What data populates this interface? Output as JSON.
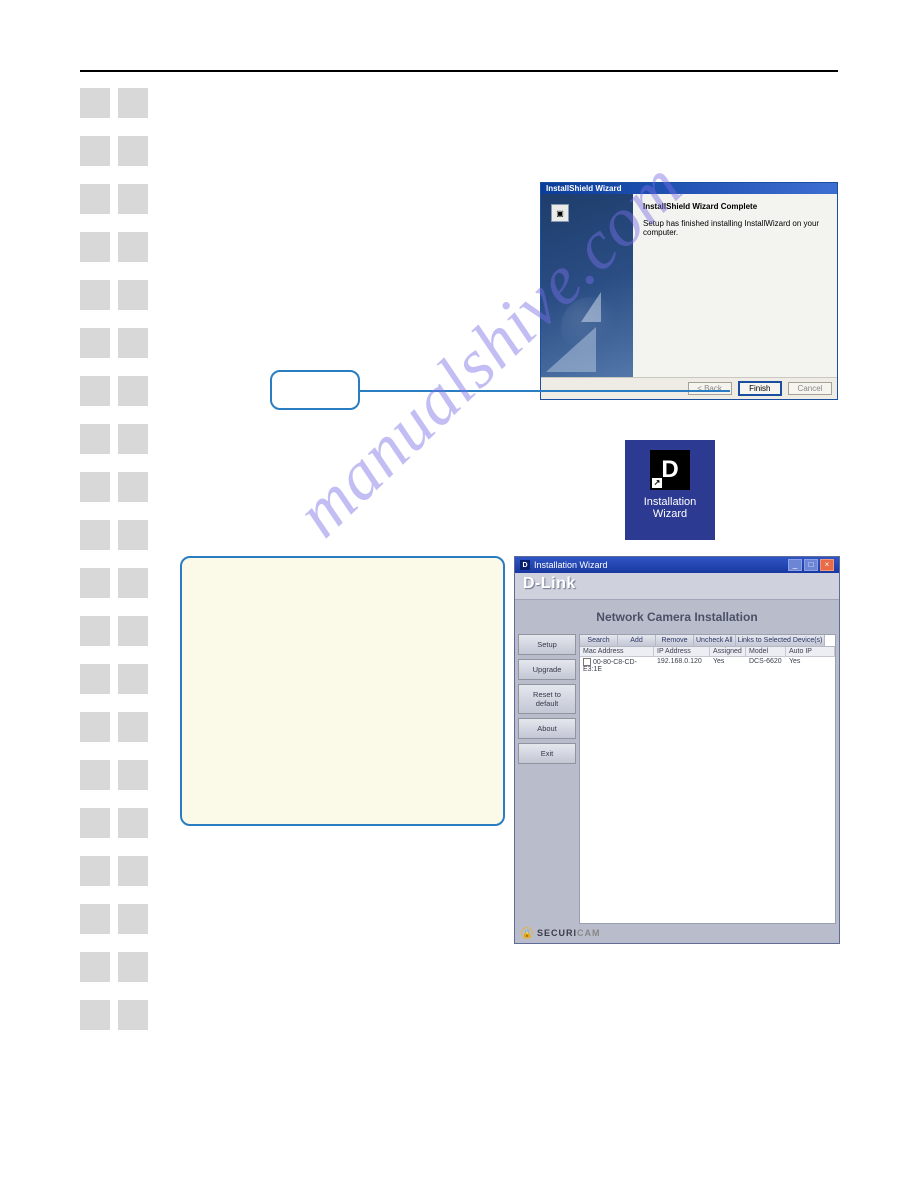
{
  "watermark": "manualshive.com",
  "installshield": {
    "title": "InstallShield Wizard",
    "heading": "InstallShield Wizard Complete",
    "body": "Setup has finished installing InstallWizard on your computer.",
    "buttons": {
      "back": "< Back",
      "finish": "Finish",
      "cancel": "Cancel"
    }
  },
  "shortcut": {
    "letter": "D",
    "label_line1": "Installation",
    "label_line2": "Wizard"
  },
  "iw": {
    "titlebar_icon": "D",
    "titlebar_text": "Installation Wizard",
    "brand": "D-Link",
    "headline": "Network Camera Installation",
    "side_buttons": [
      "Setup",
      "Upgrade",
      "Reset to default",
      "About",
      "Exit"
    ],
    "toolbar": [
      "Search",
      "Add",
      "Remove",
      "Uncheck All",
      "Links to Selected Device(s)"
    ],
    "columns": {
      "mac": "Mac Address",
      "ip": "IP Address",
      "assigned": "Assigned",
      "model": "Model",
      "auto": "Auto IP"
    },
    "row": {
      "mac": "00-80-C8-CD-E3:1E",
      "ip": "192.168.0.120",
      "assigned": "Yes",
      "model": "DCS-6620",
      "auto": "Yes"
    },
    "footer_brand_a": "SECURI",
    "footer_brand_b": "CAM"
  }
}
